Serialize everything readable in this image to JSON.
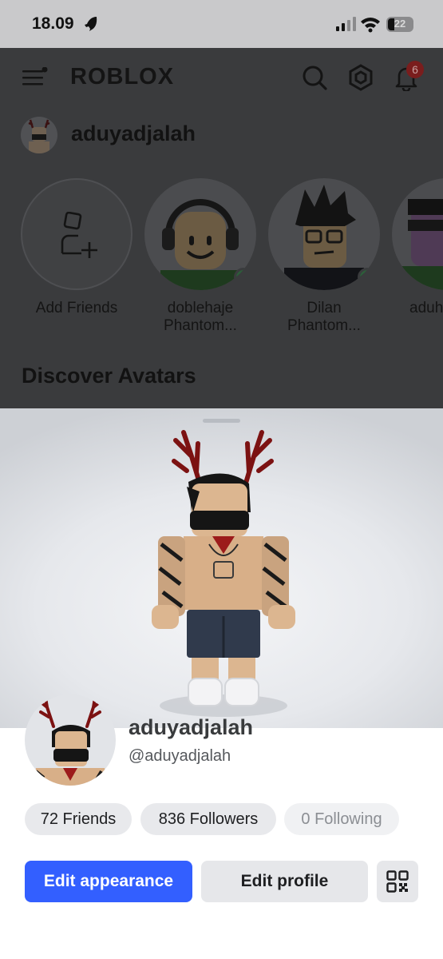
{
  "status_bar": {
    "time": "18.09",
    "battery": "22"
  },
  "header": {
    "logo": "ROBLOX",
    "notification_count": "6"
  },
  "user_row": {
    "name": "aduyadjalah"
  },
  "friends": [
    {
      "name": "Add Friends",
      "sub": ""
    },
    {
      "name": "doblehaje",
      "sub": "Phantom..."
    },
    {
      "name": "Dilan",
      "sub": "Phantom..."
    },
    {
      "name": "aduh",
      "sub": ""
    }
  ],
  "section": {
    "discover": "Discover Avatars"
  },
  "profile": {
    "display_name": "aduyadjalah",
    "username": "@aduyadjalah",
    "friends": "72 Friends",
    "followers": "836 Followers",
    "following": "0 Following",
    "edit_appearance": "Edit appearance",
    "edit_profile": "Edit profile"
  },
  "colors": {
    "primary_button": "#335fff",
    "online": "#2c5e3a",
    "badge": "#7a1d1d"
  }
}
